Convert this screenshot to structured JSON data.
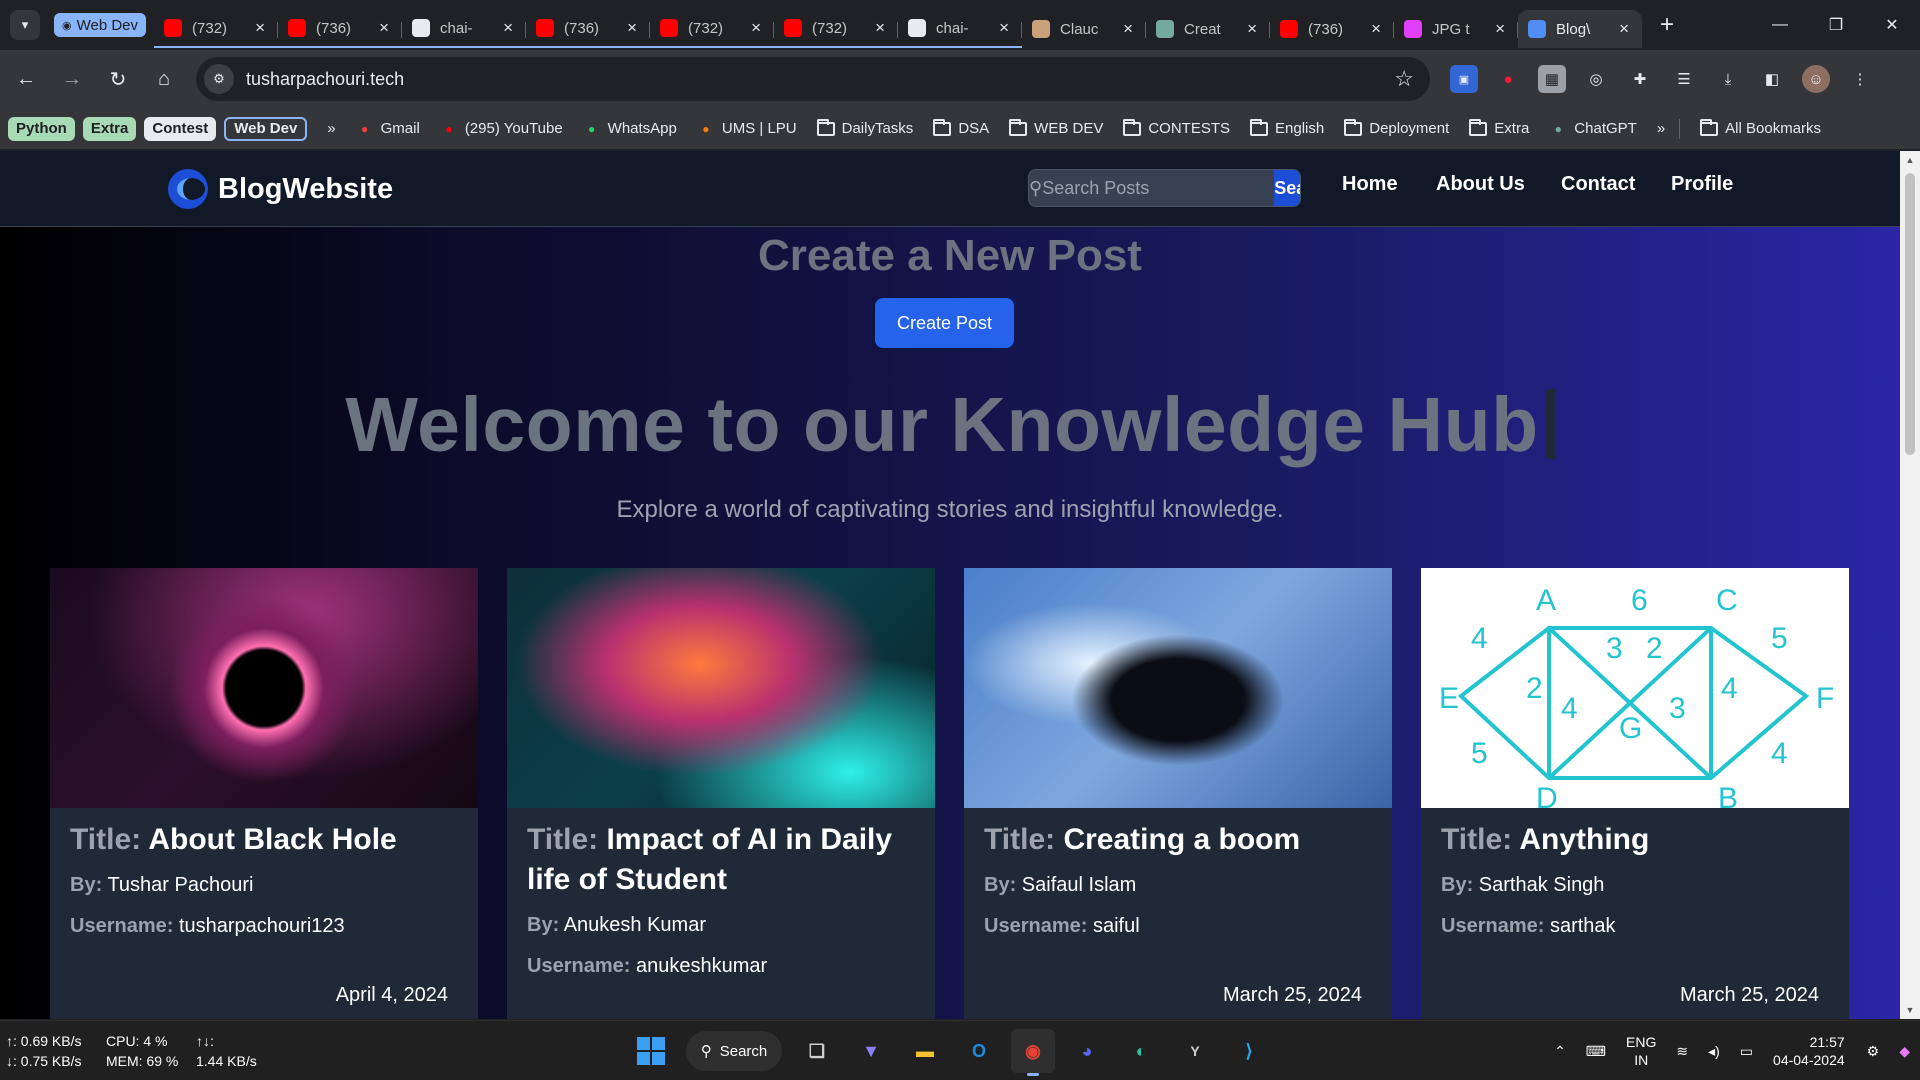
{
  "browser": {
    "tab_group": "Web Dev",
    "tabs": [
      {
        "title": "(732)",
        "icon": "youtube-record-icon",
        "color": "#ff0000"
      },
      {
        "title": "(736)",
        "icon": "youtube-icon",
        "color": "#ff0000"
      },
      {
        "title": "chai-",
        "icon": "github-icon",
        "color": "#e8eaed"
      },
      {
        "title": "(736)",
        "icon": "youtube-icon",
        "color": "#ff0000"
      },
      {
        "title": "(732)",
        "icon": "youtube-icon",
        "color": "#ff0000"
      },
      {
        "title": "(732)",
        "icon": "youtube-icon",
        "color": "#ff0000"
      },
      {
        "title": "chai-",
        "icon": "github-icon",
        "color": "#e8eaed"
      },
      {
        "title": "Clauc",
        "icon": "claude-icon",
        "color": "#c9a27a"
      },
      {
        "title": "Creat",
        "icon": "chatgpt-icon",
        "color": "#74aa9c"
      },
      {
        "title": "(736)",
        "icon": "youtube-icon",
        "color": "#ff0000"
      },
      {
        "title": "JPG t",
        "icon": "jpg-converter-icon",
        "color": "#e040fb"
      },
      {
        "title": "Blog\\",
        "icon": "blog-icon",
        "color": "#4f8df5",
        "active": true
      }
    ],
    "url": "tusharpachouri.tech",
    "bookmark_groups": [
      {
        "label": "Python",
        "color": "#a8dab5"
      },
      {
        "label": "Extra",
        "color": "#a8dab5"
      },
      {
        "label": "Contest",
        "color": "#e8eaed"
      },
      {
        "label": "Web Dev",
        "color": "#8ab4f8"
      }
    ],
    "bookmarks": [
      {
        "label": "Gmail",
        "icon": "gmail-icon"
      },
      {
        "label": "(295) YouTube",
        "icon": "youtube-icon"
      },
      {
        "label": "WhatsApp",
        "icon": "whatsapp-icon"
      },
      {
        "label": "UMS | LPU",
        "icon": "lpu-icon"
      },
      {
        "label": "DailyTasks",
        "icon": "folder-icon"
      },
      {
        "label": "DSA",
        "icon": "folder-icon"
      },
      {
        "label": "WEB DEV",
        "icon": "folder-icon"
      },
      {
        "label": "CONTESTS",
        "icon": "folder-icon"
      },
      {
        "label": "English",
        "icon": "folder-icon"
      },
      {
        "label": "Deployment",
        "icon": "folder-icon"
      },
      {
        "label": "Extra",
        "icon": "folder-icon"
      },
      {
        "label": "ChatGPT",
        "icon": "chatgpt-icon"
      }
    ],
    "all_bookmarks": "All Bookmarks"
  },
  "site": {
    "brand": "BlogWebsite",
    "search_placeholder": "Search Posts",
    "search_button": "Search",
    "menu": [
      "Home",
      "About Us",
      "Contact",
      "Profile"
    ],
    "create_title": "Create a New Post",
    "create_button": "Create Post",
    "hero_title": "Welcome to our Knowledge Hub",
    "hero_subtitle": "Explore a world of captivating stories and insightful knowledge.",
    "labels": {
      "title": "Title:",
      "by": "By:",
      "username": "Username:"
    },
    "posts": [
      {
        "title": "About Black Hole",
        "author": "Tushar Pachouri",
        "username": "tusharpachouri123",
        "date": "April 4, 2024",
        "image": "black-hole-image"
      },
      {
        "title": "Impact of AI in Daily life of Student",
        "author": "Anukesh Kumar",
        "username": "anukeshkumar",
        "date": "",
        "image": "ai-brain-image"
      },
      {
        "title": "Creating a boom",
        "author": "Saifaul Islam",
        "username": "saiful",
        "date": "March 25, 2024",
        "image": "anime-character-image"
      },
      {
        "title": "Anything",
        "author": "Sarthak Singh",
        "username": "sarthak",
        "date": "March 25, 2024",
        "image": "graph-diagram-image"
      }
    ]
  },
  "taskbar": {
    "net_up": "↑: 0.69 KB/s",
    "net_down": "↓: 0.75 KB/s",
    "cpu": "CPU: 4 %",
    "mem": "MEM: 69 %",
    "io_label": "↑↓:",
    "io_value": "1.44 KB/s",
    "search": "Search",
    "lang_top": "ENG",
    "lang_bottom": "IN",
    "time": "21:57",
    "date": "04-04-2024"
  }
}
